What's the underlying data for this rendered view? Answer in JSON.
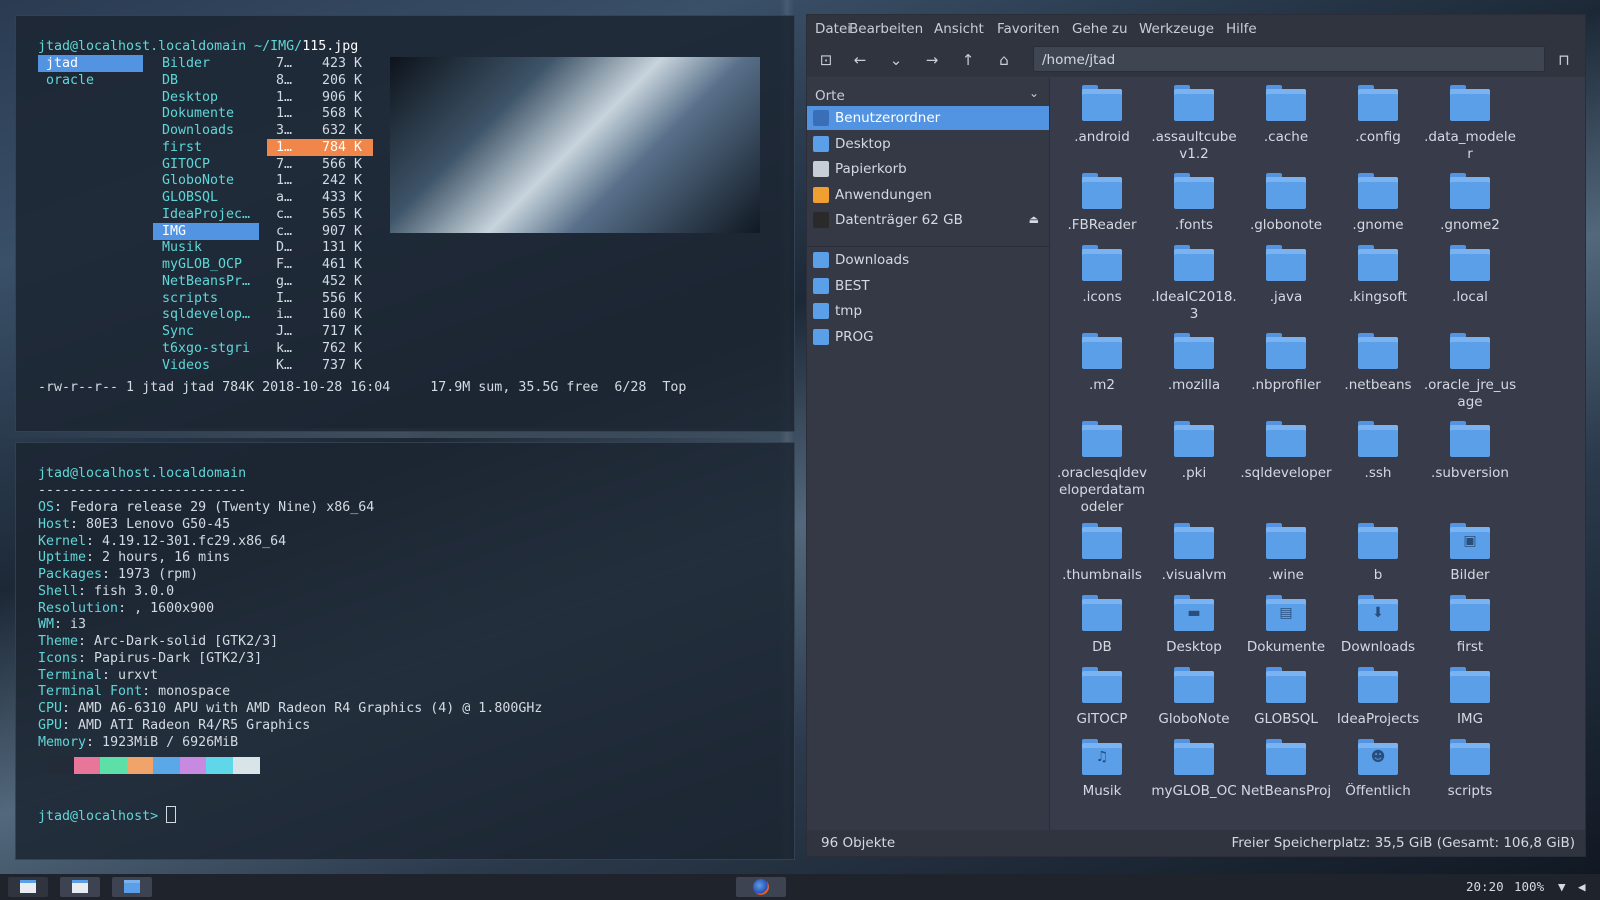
{
  "ranger": {
    "header_user": "jtad@localhost.localdomain",
    "header_path": " ~/IMG/",
    "header_file": "115.jpg",
    "left_col": [
      "jtad",
      "oracle"
    ],
    "dirs": [
      {
        "name": "Bilder",
        "info": "7…",
        "size": "423 K"
      },
      {
        "name": "DB",
        "info": "8…",
        "size": "206 K"
      },
      {
        "name": "Desktop",
        "info": "1…",
        "size": "906 K"
      },
      {
        "name": "Dokumente",
        "info": "1…",
        "size": "568 K"
      },
      {
        "name": "Downloads",
        "info": "3…",
        "size": "632 K"
      },
      {
        "name": "first",
        "info": "1…",
        "size": "784 K"
      },
      {
        "name": "GITOCP",
        "info": "7…",
        "size": "566 K"
      },
      {
        "name": "GloboNote",
        "info": "1…",
        "size": "242 K"
      },
      {
        "name": "GLOBSQL",
        "info": "a…",
        "size": "433 K"
      },
      {
        "name": "IdeaProjec…",
        "info": "c…",
        "size": "565 K"
      },
      {
        "name": "IMG",
        "info": "c…",
        "size": "907 K"
      },
      {
        "name": "Musik",
        "info": "D…",
        "size": "131 K"
      },
      {
        "name": "myGLOB_OCP",
        "info": "F…",
        "size": "461 K"
      },
      {
        "name": "NetBeansPr…",
        "info": "g…",
        "size": "452 K"
      },
      {
        "name": "scripts",
        "info": "I…",
        "size": "556 K"
      },
      {
        "name": "sqldevelop…",
        "info": "i…",
        "size": "160 K"
      },
      {
        "name": "Sync",
        "info": "J…",
        "size": "717 K"
      },
      {
        "name": "t6xgo-stgri",
        "info": "k…",
        "size": "762 K"
      },
      {
        "name": "Videos",
        "info": "K…",
        "size": "737 K"
      }
    ],
    "status": "-rw-r--r-- 1 jtad jtad 784K 2018-10-28 16:04     17.9M sum, 35.5G free  6/28  Top"
  },
  "neofetch": {
    "title": "jtad@localhost.localdomain",
    "separator": "--------------------------",
    "rows": [
      {
        "k": "OS",
        "v": ": Fedora release 29 (Twenty Nine) x86_64"
      },
      {
        "k": "Host",
        "v": ": 80E3 Lenovo G50-45"
      },
      {
        "k": "Kernel",
        "v": ": 4.19.12-301.fc29.x86_64"
      },
      {
        "k": "Uptime",
        "v": ": 2 hours, 16 mins"
      },
      {
        "k": "Packages",
        "v": ": 1973 (rpm)"
      },
      {
        "k": "Shell",
        "v": ": fish 3.0.0"
      },
      {
        "k": "Resolution",
        "v": ": , 1600x900"
      },
      {
        "k": "WM",
        "v": ": i3"
      },
      {
        "k": "Theme",
        "v": ": Arc-Dark-solid [GTK2/3]"
      },
      {
        "k": "Icons",
        "v": ": Papirus-Dark [GTK2/3]"
      },
      {
        "k": "Terminal",
        "v": ": urxvt"
      },
      {
        "k": "Terminal Font",
        "v": ": monospace"
      },
      {
        "k": "CPU",
        "v": ": AMD A6-6310 APU with AMD Radeon R4 Graphics (4) @ 1.800GHz"
      },
      {
        "k": "GPU",
        "v": ": AMD ATI Radeon R4/R5 Graphics"
      },
      {
        "k": "Memory",
        "v": ": 1923MiB / 6926MiB"
      }
    ],
    "palette": [
      "#232a38",
      "#e8769a",
      "#5de0a8",
      "#f0a46a",
      "#5aa8e8",
      "#c78ae0",
      "#5fd7e8",
      "#d8e4e8"
    ],
    "prompt": "jtad@localhost> "
  },
  "filemanager": {
    "menu": [
      "Datei",
      "Bearbeiten",
      "Ansicht",
      "Favoriten",
      "Gehe zu",
      "Werkzeuge",
      "Hilfe"
    ],
    "path": "/home/jtad",
    "places_label": "Orte",
    "places": [
      {
        "label": "Benutzerordner",
        "color": "#5294e2",
        "active": true
      },
      {
        "label": "Desktop",
        "color": "#5b9fe8"
      },
      {
        "label": "Papierkorb",
        "color": "#c8ced8"
      },
      {
        "label": "Anwendungen",
        "color": "#f0a030"
      },
      {
        "label": "Datenträger 62 GB",
        "color": "#2a2a2a",
        "eject": true
      }
    ],
    "bookmarks": [
      "Downloads",
      "BEST",
      "tmp",
      "PROG"
    ],
    "items": [
      ".android",
      ".assaultcube v1.2",
      ".cache",
      ".config",
      ".data_modeler",
      ".FBReader",
      ".fonts",
      ".globonote",
      ".gnome",
      ".gnome2",
      ".icons",
      ".IdeaIC2018.3",
      ".java",
      ".kingsoft",
      ".local",
      ".m2",
      ".mozilla",
      ".nbprofiler",
      ".netbeans",
      ".oracle_jre_usage",
      ".oraclesqldeveloperdatamodeler",
      ".pki",
      ".sqldeveloper",
      ".ssh",
      ".subversion",
      ".thumbnails",
      ".visualvm",
      ".wine",
      "b",
      "Bilder",
      "DB",
      "Desktop",
      "Dokumente",
      "Downloads",
      "first",
      "GITOCP",
      "GloboNote",
      "GLOBSQL",
      "IdeaProjects",
      "IMG",
      "Musik",
      "myGLOB_OC",
      "NetBeansProj",
      "Öffentlich",
      "scripts"
    ],
    "status_left": "96 Objekte",
    "status_right": "Freier Speicherplatz: 35,5 GiB (Gesamt: 106,8 GiB)"
  },
  "taskbar": {
    "clock": "20:20",
    "volume": "100%"
  }
}
